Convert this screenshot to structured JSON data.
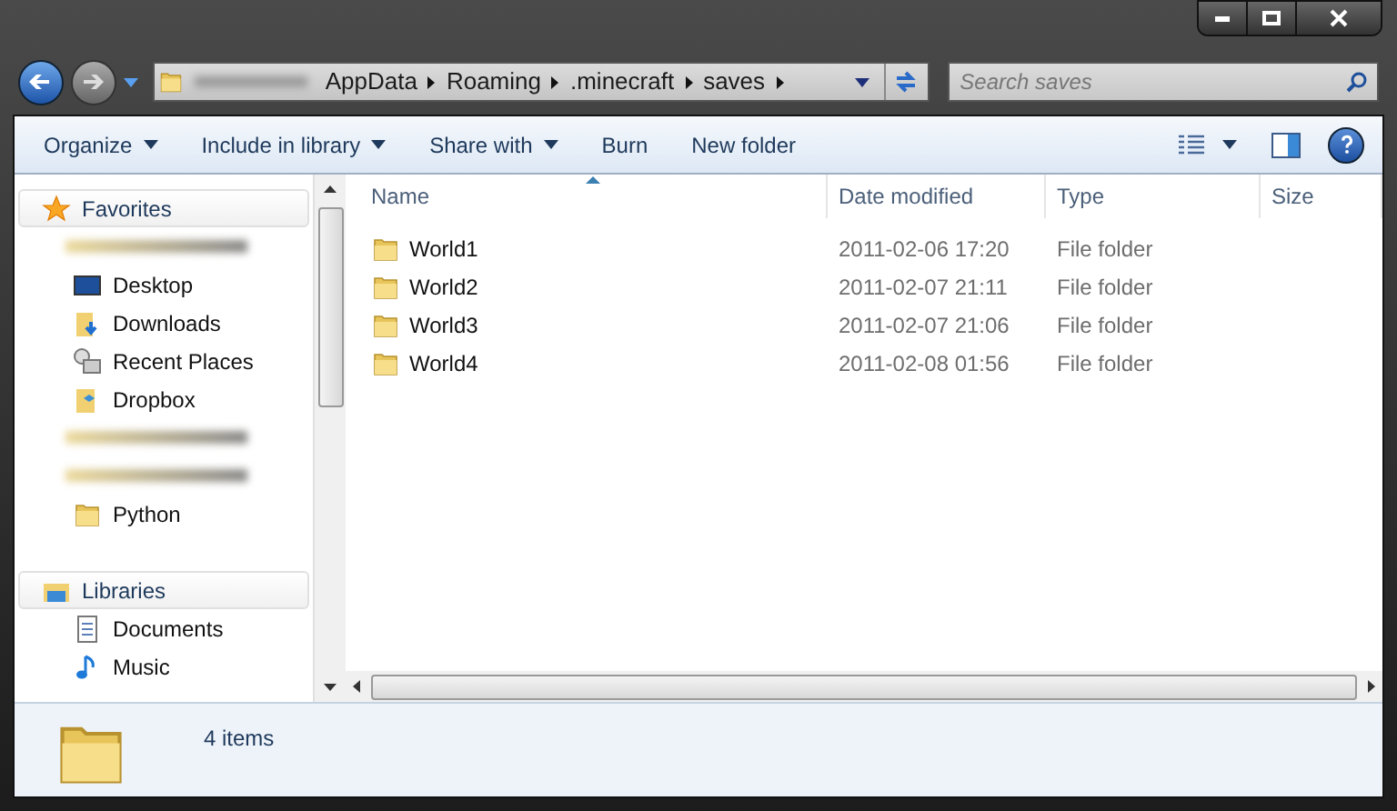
{
  "address_bar": {
    "segments": [
      "AppData",
      "Roaming",
      ".minecraft",
      "saves"
    ]
  },
  "search": {
    "placeholder": "Search saves"
  },
  "toolbar": [
    {
      "label": "Organize",
      "dropdown": true
    },
    {
      "label": "Include in library",
      "dropdown": true
    },
    {
      "label": "Share with",
      "dropdown": true
    },
    {
      "label": "Burn",
      "dropdown": false
    },
    {
      "label": "New folder",
      "dropdown": false
    }
  ],
  "nav_pane": {
    "items": [
      {
        "kind": "section",
        "label": "Favorites"
      },
      {
        "kind": "blurred"
      },
      {
        "kind": "item",
        "label": "Desktop"
      },
      {
        "kind": "item",
        "label": "Downloads"
      },
      {
        "kind": "item",
        "label": "Recent Places"
      },
      {
        "kind": "item",
        "label": "Dropbox"
      },
      {
        "kind": "blurred"
      },
      {
        "kind": "blurred"
      },
      {
        "kind": "item",
        "label": "Python"
      },
      {
        "kind": "gap"
      },
      {
        "kind": "section",
        "label": "Libraries"
      },
      {
        "kind": "item",
        "label": "Documents"
      },
      {
        "kind": "item",
        "label": "Music"
      }
    ]
  },
  "table": {
    "columns": [
      {
        "label": "Name",
        "sorted": true
      },
      {
        "label": "Date modified",
        "sorted": false
      },
      {
        "label": "Type",
        "sorted": false
      },
      {
        "label": "Size",
        "sorted": false
      }
    ],
    "rows": [
      {
        "name": "World1",
        "date": "2011-02-06 17:20",
        "type": "File folder"
      },
      {
        "name": "World2",
        "date": "2011-02-07 21:11",
        "type": "File folder"
      },
      {
        "name": "World3",
        "date": "2011-02-07 21:06",
        "type": "File folder"
      },
      {
        "name": "World4",
        "date": "2011-02-08 01:56",
        "type": "File folder"
      }
    ]
  },
  "status_bar": {
    "count": "4 items"
  }
}
